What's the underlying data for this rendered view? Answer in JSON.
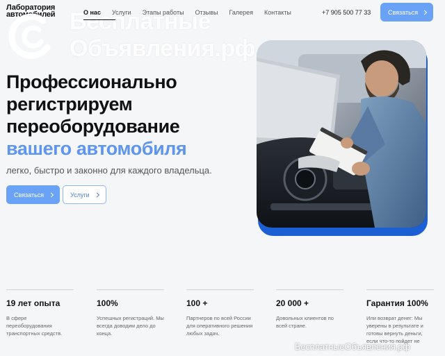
{
  "brand": {
    "line1": "Лаборатория",
    "line2": "автомобилей"
  },
  "watermark": {
    "line1": "Бесплатные",
    "line2": "Объявления.рф",
    "bottom": "БесплатныеОбъявления.рф"
  },
  "nav": {
    "items": [
      {
        "label": "О нас",
        "active": true
      },
      {
        "label": "Услуги"
      },
      {
        "label": "Этапы работы"
      },
      {
        "label": "Отзывы"
      },
      {
        "label": "Галерея"
      },
      {
        "label": "Контакты"
      }
    ],
    "phone": "+7 905 500 77 33",
    "contact_label": "Связаться"
  },
  "hero": {
    "title_lines": [
      "Профессионально",
      "регистрируем",
      "переоборудование"
    ],
    "title_accent": "вашего автомобиля",
    "subtitle": "легко, быстро и законно для каждого владельца.",
    "primary_button": "Связаться",
    "secondary_button": "Услуги"
  },
  "stats": [
    {
      "value": "19 лет опыта",
      "desc": "В сфере переоборудования транспортных средств."
    },
    {
      "value": "100%",
      "desc": "Успешных регистраций. Мы всегда доводим дело до конца."
    },
    {
      "value": "100 +",
      "desc": "Партнеров по всей России для оперативного решения любых задач."
    },
    {
      "value": "20 000 +",
      "desc": "Довольных клиентов по всей стране."
    },
    {
      "value": "Гарантия 100%",
      "desc": "Или возврат денег: Мы уверены в результате и готовы вернуть деньги, если что-то пойдет не"
    }
  ],
  "colors": {
    "accent": "#5e95ef",
    "button": "#6aa2f5",
    "photo_frame": "#1c5fd4"
  },
  "icons": {
    "chevron": "chevron-right-icon",
    "photo": "mechanic-photo"
  }
}
